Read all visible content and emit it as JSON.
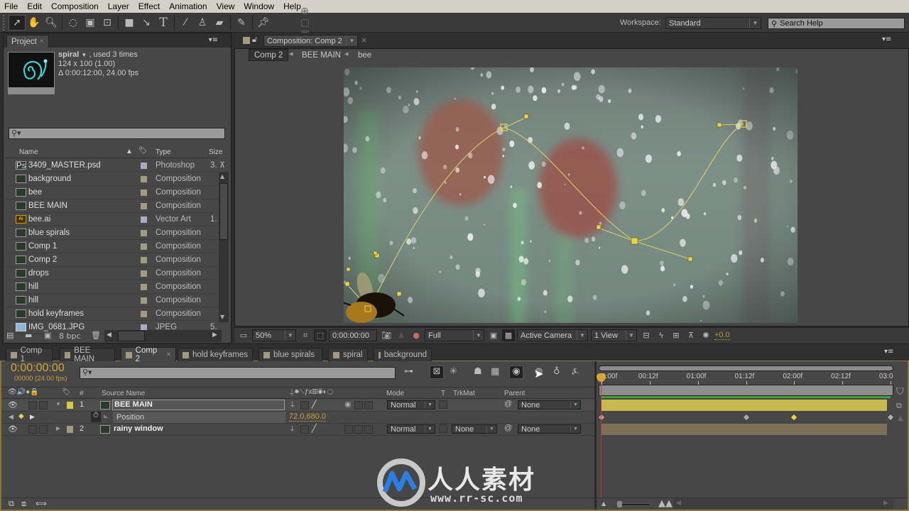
{
  "menu": [
    "File",
    "Edit",
    "Composition",
    "Layer",
    "Effect",
    "Animation",
    "View",
    "Window",
    "Help"
  ],
  "toolbar": {
    "tools": [
      "selection-tool",
      "hand-tool",
      "zoom-tool",
      "rotation-tool",
      "camera-tool",
      "pan-behind-tool",
      "rectangle-tool",
      "pen-tool",
      "text-tool",
      "brush-tool",
      "clone-stamp-tool",
      "eraser-tool",
      "roto-brush-tool",
      "puppet-pin-tool"
    ],
    "workspace_label": "Workspace:",
    "workspace_value": "Standard",
    "search_placeholder": "Search Help"
  },
  "project": {
    "tab": "Project",
    "selected": {
      "name": "spiral",
      "usage": ", used 3 times",
      "dims": "124 x 100 (1.00)",
      "duration": "Δ 0:00:12:00, 24.00 fps"
    },
    "columns": {
      "name": "Name",
      "type": "Type",
      "size": "Size"
    },
    "items": [
      {
        "name": "3409_MASTER.psd",
        "kind": "psd",
        "type": "Photoshop",
        "size": "3.",
        "label_color": "#a9a9c8"
      },
      {
        "name": "background",
        "kind": "comp",
        "type": "Composition",
        "size": "",
        "label_color": "#a39a82"
      },
      {
        "name": "bee",
        "kind": "comp",
        "type": "Composition",
        "size": "",
        "label_color": "#a39a82"
      },
      {
        "name": "BEE MAIN",
        "kind": "comp",
        "type": "Composition",
        "size": "",
        "label_color": "#a39a82"
      },
      {
        "name": "bee.ai",
        "kind": "ai",
        "type": "Vector Art",
        "size": "1.",
        "label_color": "#a9a9c8"
      },
      {
        "name": "blue spirals",
        "kind": "comp",
        "type": "Composition",
        "size": "",
        "label_color": "#a39a82"
      },
      {
        "name": "Comp 1",
        "kind": "comp",
        "type": "Composition",
        "size": "",
        "label_color": "#a39a82"
      },
      {
        "name": "Comp 2",
        "kind": "comp",
        "type": "Composition",
        "size": "",
        "label_color": "#a39a82"
      },
      {
        "name": "drops",
        "kind": "comp",
        "type": "Composition",
        "size": "",
        "label_color": "#a39a82"
      },
      {
        "name": "hill",
        "kind": "comp",
        "type": "Composition",
        "size": "",
        "label_color": "#a39a82"
      },
      {
        "name": "hill",
        "kind": "comp",
        "type": "Composition",
        "size": "",
        "label_color": "#a39a82"
      },
      {
        "name": "hold keyframes",
        "kind": "comp",
        "type": "Composition",
        "size": "",
        "label_color": "#a39a82"
      },
      {
        "name": "IMG_0681.JPG",
        "kind": "jpg",
        "type": "JPEG",
        "size": "5.",
        "label_color": "#a9a9c8"
      }
    ],
    "bit_depth": "8 bpc"
  },
  "composition": {
    "tab": "Composition: Comp 2",
    "breadcrumbs": [
      "Comp 2",
      "BEE MAIN",
      "bee"
    ],
    "zoom": "50%",
    "timecode": "0:00:00:00",
    "resolution": "Full",
    "camera": "Active Camera",
    "views": "1 View",
    "exposure": "+0.0"
  },
  "timeline": {
    "tabs": [
      "Comp 1",
      "BEE MAIN",
      "Comp 2",
      "hold keyframes",
      "blue spirals",
      "spiral",
      "background"
    ],
    "active_tab": "Comp 2",
    "timecode": "0:00:00:00",
    "frame_info": "00000 (24.00 fps)",
    "columns": {
      "num": "#",
      "source": "Source Name",
      "mode": "Mode",
      "t": "T",
      "trkmat": "TrkMat",
      "parent": "Parent"
    },
    "ruler_ticks": [
      "0:00f",
      "00:12f",
      "01:00f",
      "01:12f",
      "02:00f",
      "02:12f",
      "03:0"
    ],
    "layers": [
      {
        "num": "1",
        "name": "BEE MAIN",
        "label_color": "#d8c94a",
        "mode": "Normal",
        "trkmat": "",
        "parent": "None",
        "expanded": true
      },
      {
        "num": "2",
        "name": "rainy window",
        "label_color": "#a39a82",
        "mode": "Normal",
        "trkmat": "None",
        "parent": "None",
        "expanded": false
      }
    ],
    "property": {
      "name": "Position",
      "value": "72.0,680.0"
    },
    "keyframes_seconds": [
      0,
      1.5,
      2.0,
      3.0
    ],
    "selected_keyframe_seconds": 2.0
  },
  "watermark": {
    "text": "人人素材",
    "url": "www.rr-sc.com"
  }
}
